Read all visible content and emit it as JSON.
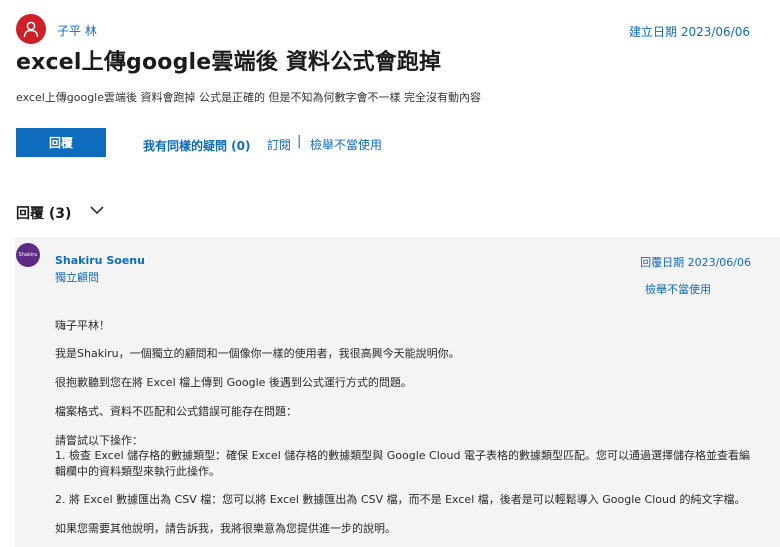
{
  "question": {
    "author": "子平 林",
    "created": "建立日期 2023/06/06",
    "title": "excel上傳google雲端後 資料公式會跑掉",
    "body": "excel上傳google雲端後 資料會跑掉 公式是正確的 但是不知為何數字會不一樣 完全沒有動內容"
  },
  "actions": {
    "reply": "回覆",
    "same_question": "我有同樣的疑問 (0)",
    "subscribe": "訂閱",
    "separator": "|",
    "report": "檢舉不當使用"
  },
  "replies_header": "回覆 (3)",
  "reply": {
    "avatar_text": "Shakiru",
    "author": "Shakiru Soenu",
    "role": "獨立顧問",
    "date": "回覆日期 2023/06/06",
    "report": "檢舉不當使用",
    "paragraphs": [
      "嗨子平林！",
      "我是Shakiru，一個獨立的顧問和一個像你一樣的使用者，我很高興今天能說明你。",
      "很抱歉聽到您在將 Excel 檔上傳到 Google 後遇到公式運行方式的問題。",
      "檔案格式、資料不匹配和公式錯誤可能存在問題：",
      "請嘗試以下操作：",
      "1. 檢查 Excel 儲存格的數據類型：確保 Excel 儲存格的數據類型與 Google Cloud 電子表格的數據類型匹配。您可以通過選擇儲存格並查看編輯欄中的資料類型來執行此操作。",
      "2. 將 Excel 數據匯出為 CSV 檔：您可以將 Excel 數據匯出為 CSV 檔，而不是 Excel 檔，後者是可以輕鬆導入 Google Cloud 的純文字檔。",
      "如果您需要其他說明，請告訴我，我將很樂意為您提供進一步的說明。"
    ]
  },
  "colors": {
    "accent": "#0f6cbd",
    "avatar_red": "#cf2027",
    "avatar_purple": "#5b2b86",
    "card_bg": "#f4f4f4"
  }
}
